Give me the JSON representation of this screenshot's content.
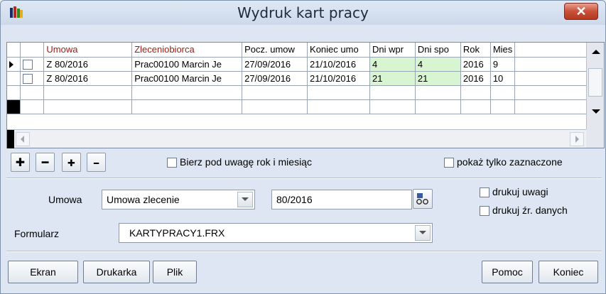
{
  "window": {
    "title": "Wydruk kart pracy",
    "close_label": "✕"
  },
  "grid": {
    "headers": [
      "Umowa",
      "Zleceniobiorca",
      "Pocz. umow",
      "Koniec umo",
      "Dni wpr",
      "Dni spo",
      "Rok",
      "Mies"
    ],
    "rows": [
      {
        "umowa": "Z 80/2016",
        "zleceniobiorca": "Prac00100 Marcin Je",
        "pocz": "27/09/2016",
        "koniec": "21/10/2016",
        "dni_wpr": "4",
        "dni_spo": "4",
        "rok": "2016",
        "mies": "9"
      },
      {
        "umowa": "Z 80/2016",
        "zleceniobiorca": "Prac00100 Marcin Je",
        "pocz": "27/09/2016",
        "koniec": "21/10/2016",
        "dni_wpr": "21",
        "dni_spo": "21",
        "rok": "2016",
        "mies": "10"
      }
    ]
  },
  "toolbar": {
    "add_icon": "✚",
    "remove_icon": "━",
    "add_all_icon": "✚",
    "remove_all_icon": "━",
    "year_month_label": "Bierz pod uwagę rok i miesiąc",
    "show_selected_label": "pokaż tylko zaznaczone"
  },
  "form": {
    "umowa_label": "Umowa",
    "umowa_type": "Umowa zlecenie",
    "umowa_number": "80/2016",
    "formularz_label": "Formularz",
    "formularz_value": "KARTYPRACY1.FRX",
    "print_notes_label": "drukuj uwagi",
    "print_source_label": "drukuj źr. danych"
  },
  "buttons": {
    "ekran": "Ekran",
    "drukarka": "Drukarka",
    "plik": "Plik",
    "pomoc": "Pomoc",
    "koniec": "Koniec"
  }
}
